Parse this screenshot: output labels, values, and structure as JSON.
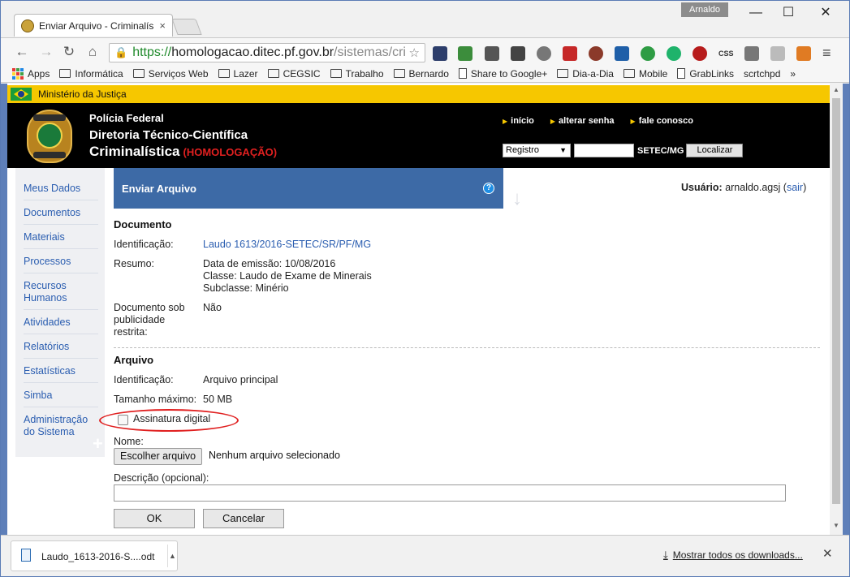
{
  "browser": {
    "tab_title": "Enviar Arquivo - Criminalís",
    "tab_close": "×",
    "user_badge": "Arnaldo",
    "win_min": "—",
    "win_max": "☐",
    "win_close": "✕",
    "url_scheme": "https://",
    "url_host": "homologacao.ditec.pf.gov.br",
    "url_path": "/sistemas/cri",
    "star": "☆",
    "menu": "≡"
  },
  "bookmarks": [
    {
      "label": "Apps",
      "kind": "apps"
    },
    {
      "label": "Informática",
      "kind": "folder"
    },
    {
      "label": "Serviços Web",
      "kind": "folder"
    },
    {
      "label": "Lazer",
      "kind": "folder"
    },
    {
      "label": "CEGSIC",
      "kind": "folder"
    },
    {
      "label": "Trabalho",
      "kind": "folder"
    },
    {
      "label": "Bernardo",
      "kind": "folder"
    },
    {
      "label": "Share to Google+",
      "kind": "page"
    },
    {
      "label": "Dia-a-Dia",
      "kind": "folder"
    },
    {
      "label": "Mobile",
      "kind": "folder"
    },
    {
      "label": "GrabLinks",
      "kind": "page"
    },
    {
      "label": "scrtchpd",
      "kind": "none"
    },
    {
      "label": "»",
      "kind": "none"
    }
  ],
  "header": {
    "ministry": "Ministério da Justiça",
    "line1": "Polícia Federal",
    "line2": "Diretoria Técnico-Científica",
    "line3": "Criminalística",
    "env": "(HOMOLOGAÇÃO)",
    "links": [
      "início",
      "alterar senha",
      "fale conosco"
    ],
    "search_select": "Registro",
    "unit": "SETEC/MG",
    "search_button": "Localizar"
  },
  "sidebar": {
    "items": [
      "Meus Dados",
      "Documentos",
      "Materiais",
      "Processos",
      "Recursos Humanos",
      "Atividades",
      "Relatórios",
      "Estatísticas",
      "Simba",
      "Administração do Sistema"
    ]
  },
  "main": {
    "page_title": "Enviar Arquivo",
    "help": "?",
    "user_label": "Usuário:",
    "user_name": "arnaldo.agsj",
    "logout": "sair",
    "document": {
      "section": "Documento",
      "id_label": "Identificação:",
      "id_value": "Laudo 1613/2016-SETEC/SR/PF/MG",
      "summary_label": "Resumo:",
      "summary_lines": [
        "Data de emissão: 10/08/2016",
        "Classe: Laudo de Exame de Minerais",
        "Subclasse: Minério"
      ],
      "restricted_label_lines": [
        "Documento sob",
        "publicidade",
        "restrita:"
      ],
      "restricted_value": "Não"
    },
    "file": {
      "section": "Arquivo",
      "id_label": "Identificação:",
      "id_value": "Arquivo principal",
      "max_label": "Tamanho máximo:",
      "max_value": "50 MB",
      "signature_label": "Assinatura digital",
      "name_label": "Nome:",
      "choose_button": "Escolher arquivo",
      "no_file": "Nenhum arquivo selecionado",
      "desc_label": "Descrição (opcional):",
      "desc_value": "",
      "ok": "OK",
      "cancel": "Cancelar"
    }
  },
  "downloads": {
    "file_name": "Laudo_1613-2016-S....odt",
    "show_all": "Mostrar todos os downloads...",
    "close": "✕"
  }
}
